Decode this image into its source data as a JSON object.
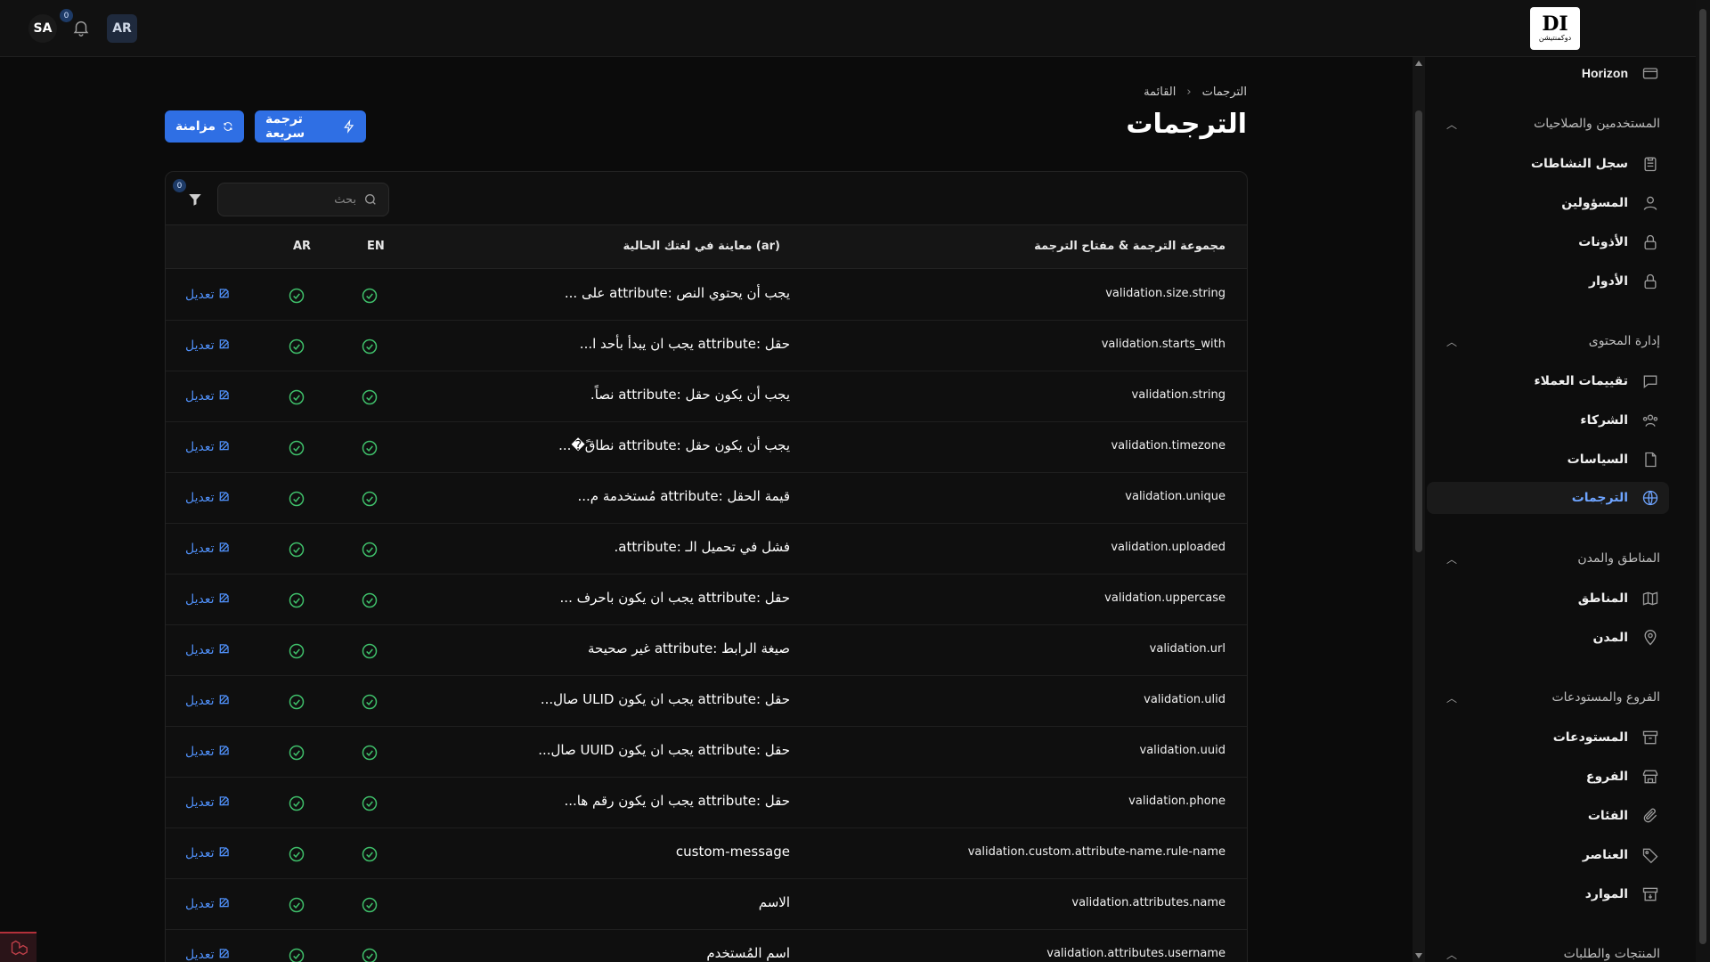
{
  "topbar": {
    "user_initials": "SA",
    "notification_count": "0",
    "language": "AR",
    "logo_mark": "DI",
    "logo_name": "دوكمنتيشن"
  },
  "sidebar": {
    "top_item": "Horizon",
    "sections": {
      "users": "المستخدمين والصلاحيات",
      "content": "إدارة المحتوى",
      "regions": "المناطق والمدن",
      "branches": "الفروع والمستودعات",
      "products": "المنتجات والطلبات"
    },
    "items": {
      "activity_log": "سجل النشاطات",
      "admins": "المسؤولين",
      "permissions": "الأذونات",
      "roles": "الأدوار",
      "reviews": "تقييمات العملاء",
      "partners": "الشركاء",
      "policies": "السياسات",
      "translations": "الترجمات",
      "regions": "المناطق",
      "cities": "المدن",
      "warehouses": "المستودعات",
      "branches": "الفروع",
      "categories": "الفئات",
      "items": "العناصر",
      "resources": "الموارد"
    }
  },
  "header": {
    "breadcrumb_current": "الترجمات",
    "breadcrumb_parent": "القائمة",
    "title": "الترجمات"
  },
  "actions": {
    "quick_translate": "ترجمة سريعة",
    "sync": "مزامنة"
  },
  "toolbar": {
    "search_placeholder": "بحث",
    "filter_count": "0"
  },
  "table": {
    "headers": {
      "key": "مجموعة الترجمة & مفتاح الترجمة",
      "preview": "معاينة في لغتك الحالية (ar)",
      "en": "EN",
      "ar": "AR"
    },
    "edit_label": "تعديل",
    "rows": [
      {
        "key": "validation.size.string",
        "preview": "يجب أن يحتوي النص :attribute على ..."
      },
      {
        "key": "validation.starts_with",
        "preview": "حقل :attribute يجب ان يبدأ بأحد ا..."
      },
      {
        "key": "validation.string",
        "preview": "يجب أن يكون حقل :attribute نصاً."
      },
      {
        "key": "validation.timezone",
        "preview": "يجب أن يكون حقل :attribute نطاقً�..."
      },
      {
        "key": "validation.unique",
        "preview": "قيمة الحقل :attribute مُستخدمة م..."
      },
      {
        "key": "validation.uploaded",
        "preview": "فشل في تحميل الـ :attribute."
      },
      {
        "key": "validation.uppercase",
        "preview": "حقل :attribute يجب ان يكون باحرف ..."
      },
      {
        "key": "validation.url",
        "preview": "صيغة الرابط :attribute غير صحيحة"
      },
      {
        "key": "validation.ulid",
        "preview": "حقل :attribute يجب ان يكون ULID صال..."
      },
      {
        "key": "validation.uuid",
        "preview": "حقل :attribute يجب ان يكون UUID صال..."
      },
      {
        "key": "validation.phone",
        "preview": "حقل :attribute يجب ان يكون رقم ها..."
      },
      {
        "key": "validation.custom.attribute-name.rule-name",
        "preview": "custom-message"
      },
      {
        "key": "validation.attributes.name",
        "preview": "الاسم"
      },
      {
        "key": "validation.attributes.username",
        "preview": "اسم المُستخدم"
      }
    ]
  },
  "colors": {
    "accent": "#2f6fe4",
    "link": "#4f8ff7",
    "check": "#3fbf6a"
  }
}
